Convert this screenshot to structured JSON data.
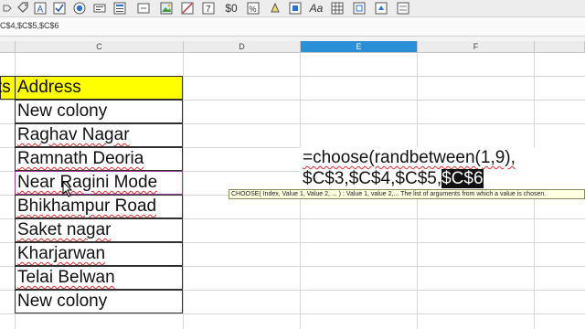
{
  "toolbar": {
    "icons": [
      "tag-icon",
      "text-box-icon",
      "checkbox-icon",
      "radio-button-icon",
      "label-icon",
      "image-icon",
      "no-image-icon",
      "number-icon",
      "currency-icon",
      "percent-icon",
      "font-icon",
      "grid-icon",
      "paint-icon",
      "picture-icon"
    ],
    "currency_label": "$0",
    "number_label": "7",
    "font_label": "Aa"
  },
  "formula_bar": {
    "text": "C$4,$C$5,$C$6"
  },
  "columns": [
    {
      "name": "C"
    },
    {
      "name": "D"
    },
    {
      "name": "E",
      "selected": true
    },
    {
      "name": "F"
    }
  ],
  "sheet": {
    "left_header_fragment": "ts",
    "address_header": "Address",
    "header_fill": "#ffff00",
    "addresses": [
      "New colony",
      "Raghav Nagar",
      "Ramnath Deoria",
      "Near Ragini Mode",
      "Bhikhampur Road",
      "Saket nagar",
      "Kharjarwan",
      "Telai Belwan",
      "New colony"
    ]
  },
  "formula_cell": {
    "line1": "=choose(randbetween(1,9),",
    "line2_plain": "$C$3,$C$4,$C$5,",
    "line2_highlight": "$C$6"
  },
  "tooltip": {
    "text": "CHOOSE( Index, Value 1, Value 2, ...  ) : Value 1, value 2,... The list of arguments from which a value is chosen."
  },
  "colors": {
    "selected_header": "#2a8fd6",
    "cell_cursor": "#9b3a8f",
    "tooltip_bg": "#ffffe1"
  }
}
